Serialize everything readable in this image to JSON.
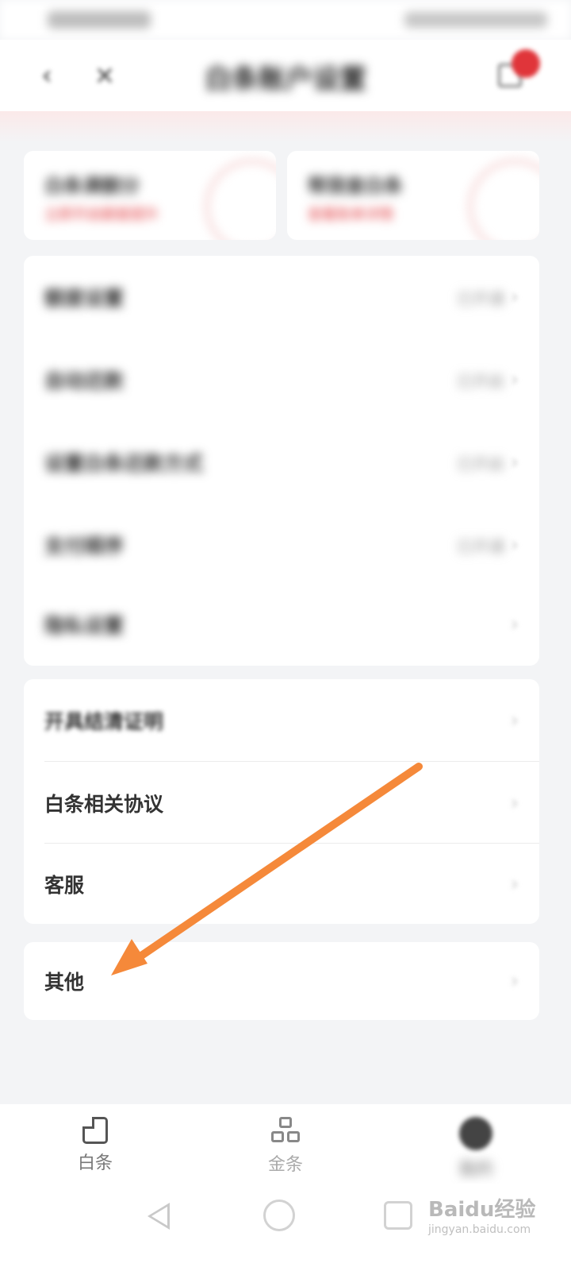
{
  "header": {
    "title": "白条账户设置"
  },
  "top_cards": [
    {
      "title": "白条满额分",
      "subtitle": "立即开启额度提升"
    },
    {
      "title": "帮我查白条",
      "subtitle": "查看账单详情"
    }
  ],
  "settings_group_1": [
    {
      "label": "额度设置",
      "value": "已开通"
    },
    {
      "label": "自动还款",
      "value": "已开启"
    },
    {
      "label": "设置白条还款方式",
      "value": "已开启"
    },
    {
      "label": "支付顺序",
      "value": "已开通"
    },
    {
      "label": "隐私设置",
      "value": ""
    }
  ],
  "settings_group_2": [
    {
      "label": "开具结清证明"
    },
    {
      "label": "白条相关协议"
    },
    {
      "label": "客服"
    }
  ],
  "settings_group_3": [
    {
      "label": "其他"
    }
  ],
  "chevron": "›",
  "tab_bar": [
    {
      "label": "白条",
      "icon": "document-icon"
    },
    {
      "label": "金条",
      "icon": "grid-icon"
    },
    {
      "label": "我的",
      "icon": "avatar-icon"
    }
  ],
  "watermark": {
    "brand": "Baidu经验",
    "url": "jingyan.baidu.com"
  },
  "colors": {
    "accent_red": "#e0353a",
    "annotation_arrow": "#f5893a",
    "background": "#f3f4f6"
  }
}
